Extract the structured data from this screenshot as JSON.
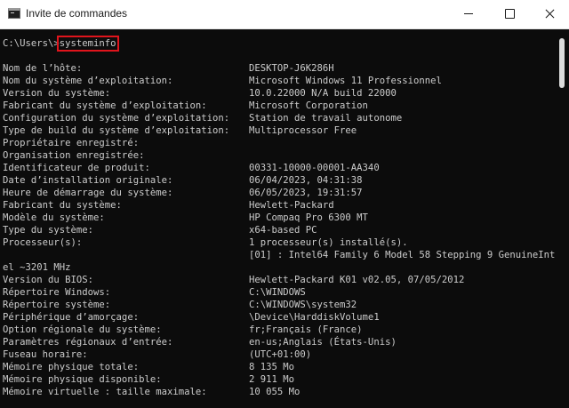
{
  "window": {
    "title": "Invite de commandes",
    "icon": "command-prompt-icon",
    "controls": [
      "minimize-icon",
      "maximize-icon",
      "close-icon"
    ]
  },
  "console": {
    "prompt": "C:\\Users\\>",
    "command": "systeminfo",
    "lines": [
      {
        "key": "Nom de l’hôte:",
        "value": "DESKTOP-J6K286H"
      },
      {
        "key": "Nom du système d’exploitation:",
        "value": "Microsoft Windows 11 Professionnel"
      },
      {
        "key": "Version du système:",
        "value": "10.0.22000 N/A build 22000"
      },
      {
        "key": "Fabricant du système d’exploitation:",
        "value": "Microsoft Corporation"
      },
      {
        "key": "Configuration du système d’exploitation:",
        "value": "Station de travail autonome"
      },
      {
        "key": "Type de build du système d’exploitation:",
        "value": "Multiprocessor Free"
      },
      {
        "key": "Propriétaire enregistré:",
        "value": ""
      },
      {
        "key": "Organisation enregistrée:",
        "value": ""
      },
      {
        "key": "Identificateur de produit:",
        "value": "00331-10000-00001-AA340"
      },
      {
        "key": "Date d’installation originale:",
        "value": "06/04/2023, 04:31:38"
      },
      {
        "key": "Heure de démarrage du système:",
        "value": "06/05/2023, 19:31:57"
      },
      {
        "key": "Fabricant du système:",
        "value": "Hewlett-Packard"
      },
      {
        "key": "Modèle du système:",
        "value": "HP Compaq Pro 6300 MT"
      },
      {
        "key": "Type du système:",
        "value": "x64-based PC"
      },
      {
        "key": "Processeur(s):",
        "value": "1 processeur(s) installé(s)."
      },
      {
        "key": "",
        "value": "[01] : Intel64 Family 6 Model 58 Stepping 9 GenuineInt"
      },
      {
        "key": "el ~3201 MHz",
        "value": ""
      },
      {
        "key": "Version du BIOS:",
        "value": "Hewlett-Packard K01 v02.05, 07/05/2012"
      },
      {
        "key": "Répertoire Windows:",
        "value": "C:\\WINDOWS"
      },
      {
        "key": "Répertoire système:",
        "value": "C:\\WINDOWS\\system32"
      },
      {
        "key": "Périphérique d’amorçage:",
        "value": "\\Device\\HarddiskVolume1"
      },
      {
        "key": "Option régionale du système:",
        "value": "fr;Français (France)"
      },
      {
        "key": "Paramètres régionaux d’entrée:",
        "value": "en-us;Anglais (États-Unis)"
      },
      {
        "key": "Fuseau horaire:",
        "value": "(UTC+01:00)"
      },
      {
        "key": "Mémoire physique totale:",
        "value": "8 135 Mo"
      },
      {
        "key": "Mémoire physique disponible:",
        "value": "2 911 Mo"
      },
      {
        "key": "Mémoire virtuelle : taille maximale:",
        "value": "10 055 Mo"
      }
    ]
  },
  "colors": {
    "console_bg": "#0c0c0c",
    "console_text": "#cccccc",
    "highlight": "#e0141c"
  }
}
